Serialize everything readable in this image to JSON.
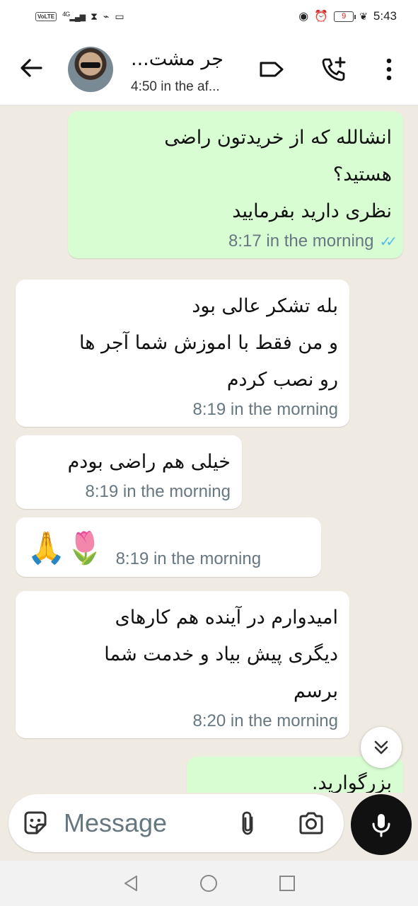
{
  "status_bar": {
    "network": "VoLTE",
    "signal": "4G",
    "battery": "9",
    "time": "5:43"
  },
  "header": {
    "contact_name": "جر مشت...",
    "last_seen": "4:50 in the af..."
  },
  "messages": [
    {
      "direction": "out",
      "lines": [
        "انشالله که از خریدتون راضی",
        "هستید؟",
        "نظری دارید بفرمایید"
      ],
      "time": "8:17 in the morning",
      "read": true
    },
    {
      "direction": "in",
      "lines": [
        "بله تشکر عالی بود",
        "و من فقط با اموزش شما آجر ها",
        "رو نصب کردم"
      ],
      "time": "8:19 in the morning"
    },
    {
      "direction": "in",
      "lines": [
        "خیلی هم راضی بودم"
      ],
      "time": "8:19 in the morning"
    },
    {
      "direction": "in",
      "lines": [
        "🙏🌷"
      ],
      "time": "8:19 in the morning"
    },
    {
      "direction": "in",
      "lines": [
        "امیدوارم در آینده هم کارهای",
        "دیگری پیش بیاد و خدمت شما",
        "برسم"
      ],
      "time": "8:20 in the morning"
    },
    {
      "direction": "out",
      "lines": [
        "بزرگوارید."
      ],
      "time": ""
    }
  ],
  "composer": {
    "placeholder": "Message"
  },
  "colors": {
    "outgoing_bubble": "#d9fdd3",
    "incoming_bubble": "#ffffff",
    "chat_background": "#efeae2",
    "read_ticks": "#53bdeb"
  }
}
